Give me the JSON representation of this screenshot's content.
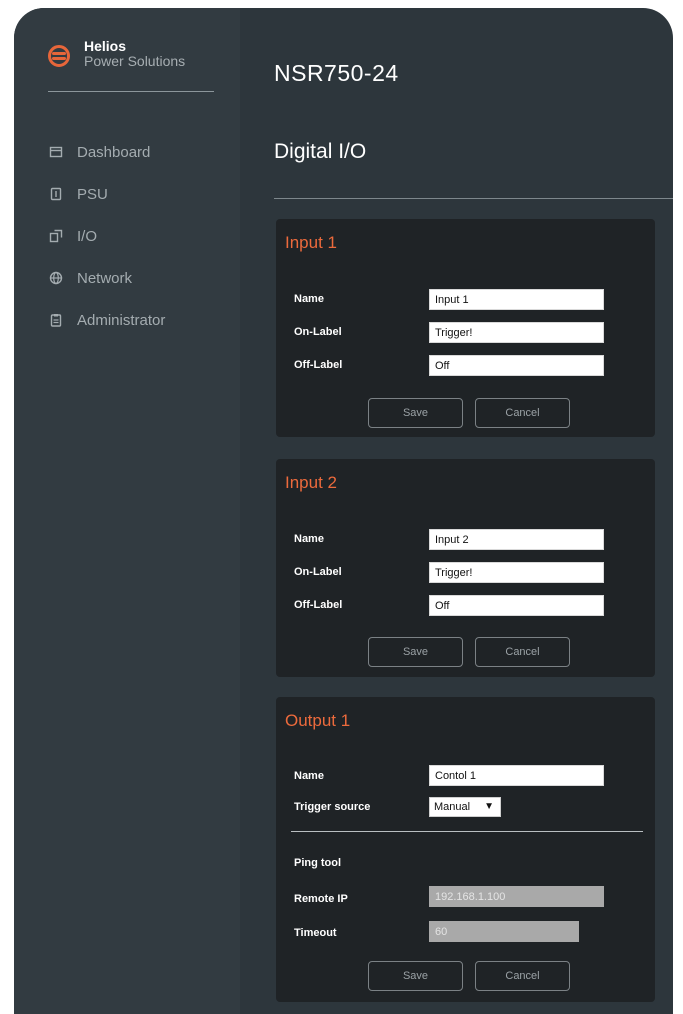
{
  "brand": {
    "name": "Helios",
    "subtitle": "Power Solutions"
  },
  "nav": [
    {
      "label": "Dashboard",
      "icon": "dashboard-icon"
    },
    {
      "label": "PSU",
      "icon": "psu-icon"
    },
    {
      "label": "I/O",
      "icon": "io-icon"
    },
    {
      "label": "Network",
      "icon": "globe-icon"
    },
    {
      "label": "Administrator",
      "icon": "clipboard-icon"
    }
  ],
  "header": {
    "device": "NSR750-24",
    "page_title": "Digital I/O"
  },
  "input1": {
    "title": "Input 1",
    "name_label": "Name",
    "name_value": "Input 1",
    "on_label": "On-Label",
    "on_value": "Trigger!",
    "off_label": "Off-Label",
    "off_value": "Off",
    "save": "Save",
    "cancel": "Cancel"
  },
  "input2": {
    "title": "Input 2",
    "name_label": "Name",
    "name_value": "Input 2",
    "on_label": "On-Label",
    "on_value": "Trigger!",
    "off_label": "Off-Label",
    "off_value": "Off",
    "save": "Save",
    "cancel": "Cancel"
  },
  "output1": {
    "title": "Output 1",
    "name_label": "Name",
    "name_value": "Contol 1",
    "trigger_label": "Trigger source",
    "trigger_value": "Manual",
    "ping_title": "Ping tool",
    "remote_ip_label": "Remote IP",
    "remote_ip_value": "192.168.1.100",
    "timeout_label": "Timeout",
    "timeout_value": "60",
    "save": "Save",
    "cancel": "Cancel"
  },
  "colors": {
    "accent": "#ec6a3c",
    "sidebar": "#323b41",
    "background": "#2d363c",
    "card": "#1f2326"
  }
}
